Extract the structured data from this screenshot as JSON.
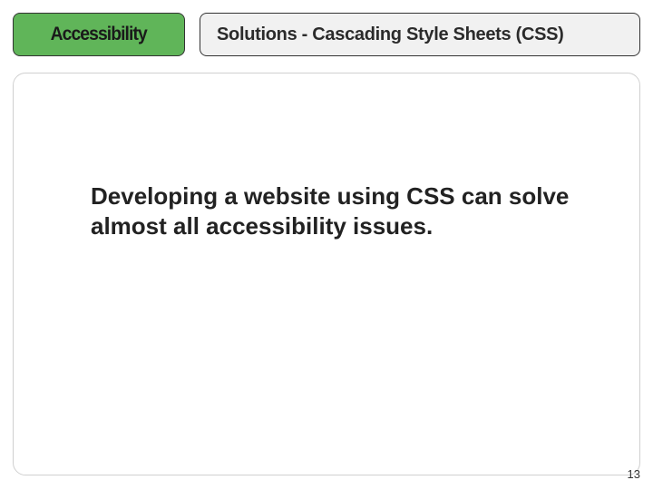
{
  "header": {
    "badge": "Accessibility",
    "title": "Solutions - Cascading Style Sheets (CSS)"
  },
  "body": {
    "text": "Developing a website using CSS can solve almost all accessibility issues."
  },
  "page_number": "13"
}
